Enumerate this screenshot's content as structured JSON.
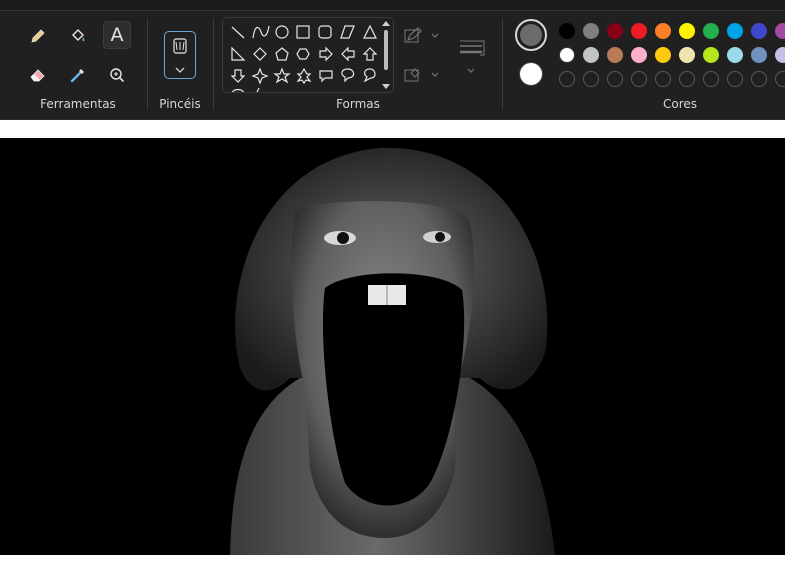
{
  "groups": {
    "tools_label": "Ferramentas",
    "brushes_label": "Pincéis",
    "shapes_label": "Formas",
    "colors_label": "Cores"
  },
  "tools": {
    "text_glyph": "A"
  },
  "colors": {
    "color1": "#6b6b6b",
    "color2": "#ffffff",
    "row1": [
      "#000000",
      "#7f7f7f",
      "#880015",
      "#ed1c24",
      "#ff7f27",
      "#fff200",
      "#22b14c",
      "#00a2e8",
      "#3f48cc",
      "#a349a4"
    ],
    "row2": [
      "#ffffff",
      "#c3c3c3",
      "#b97a57",
      "#ffaec9",
      "#ffc90e",
      "#efe4b0",
      "#b5e61d",
      "#99d9ea",
      "#7092be",
      "#c8bfe7"
    ],
    "row3_count": 10
  }
}
